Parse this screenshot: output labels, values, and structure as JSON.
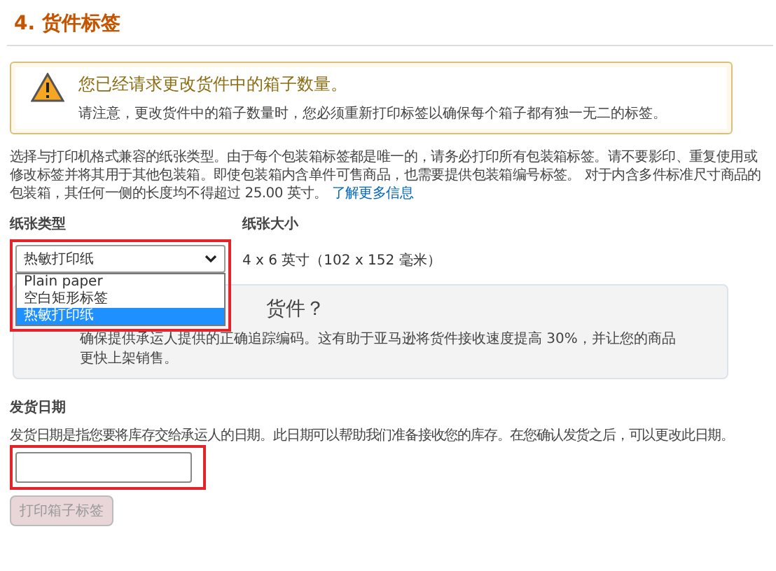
{
  "section_title": "4. 货件标签",
  "alert": {
    "title": "您已经请求更改货件中的箱子数量。",
    "body": "请注意，更改货件中的箱子数量时，您必须重新打印标签以确保每个箱子都有独一无二的标签。"
  },
  "intro": {
    "text": "选择与打印机格式兼容的纸张类型。由于每个包装箱标签都是唯一的，请务必打印所有包装箱标签。请不要影印、重复使用或修改标签并将其用于其他包装箱。即使包装箱内含单件可售商品，也需要提供包装箱编号标签。 对于内含多件标准尺寸商品的包装箱，其任何一侧的长度均不得超过 25.00 英寸。",
    "link": "了解更多信息"
  },
  "paper_type": {
    "label": "纸张类型",
    "value": "热敏打印纸",
    "expanded": true,
    "highlighted": true,
    "options": [
      {
        "label": "Plain paper",
        "selected": false
      },
      {
        "label": "空白矩形标签",
        "selected": false
      },
      {
        "label": "热敏打印纸",
        "selected": true
      }
    ]
  },
  "paper_size": {
    "label": "纸张大小",
    "value": "4 x 6 英寸（102 x 152 毫米）"
  },
  "info_box": {
    "title": "货件？",
    "body": "确保提供承运人提供的正确追踪编码。这有助于亚马逊将货件接收速度提高 30%，并让您的商品更快上架销售。"
  },
  "ship_date": {
    "label": "发货日期",
    "description": "发货日期是指您要将库存交给承运人的日期。此日期可以帮助我们准备接收您的库存。在您确认发货之后，可以更改此日期。",
    "highlighted": true
  },
  "print_button": {
    "label": "打印箱子标签",
    "disabled": true
  }
}
